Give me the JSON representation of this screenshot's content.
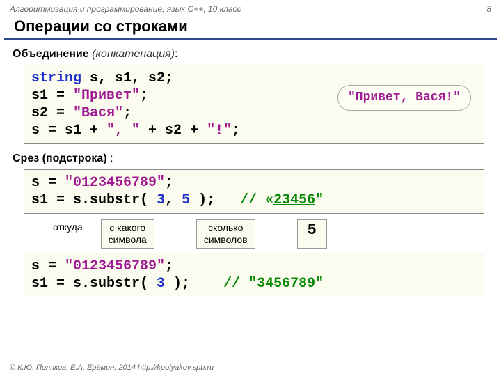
{
  "header": {
    "course": "Алгоритмизация и программирование, язык C++, 10 класс",
    "page_num": "8"
  },
  "title": "Операции со строками",
  "section1": {
    "bold": "Объединение ",
    "ital": "(конкатенация)",
    "tail": ":"
  },
  "code1": {
    "l1a": "string",
    "l1b": " s, s1, s2;",
    "l2a": "s1 = ",
    "l2b": "\"Привет\"",
    "l2c": ";",
    "l3a": "s2 = ",
    "l3b": "\"Вася\"",
    "l3c": ";",
    "l4a": "s = s1 + ",
    "l4b": "\", \"",
    "l4c": " + s2 + ",
    "l4d": "\"!\"",
    "l4e": ";"
  },
  "bubble1": "\"Привет, Вася!\"",
  "section2": {
    "bold": "Срез (подстрока)",
    "tail": " :"
  },
  "code2": {
    "l1a": "s = ",
    "l1b": "\"0123456789\"",
    "l1c": ";",
    "l2a": "s1 = s.substr( ",
    "l2b": "3",
    "l2c": ", ",
    "l2d": "5",
    "l2e": " );   ",
    "l2f": "// «",
    "l2g": "23456",
    "l2h": "\""
  },
  "annot": {
    "a1": "откуда",
    "a2": "с какого\nсимвола",
    "a3": "сколько\nсимволов",
    "a4": "5"
  },
  "code3": {
    "l1a": "s = ",
    "l1b": "\"0123456789\"",
    "l1c": ";",
    "l2a": "s1 = s.substr( ",
    "l2b": "3",
    "l2c": " );    ",
    "l2d": "// ",
    "l2e": "\"3456789\""
  },
  "footer": "© К.Ю. Поляков, Е.А. Ерёмин, 2014   http://kpolyakov.spb.ru"
}
